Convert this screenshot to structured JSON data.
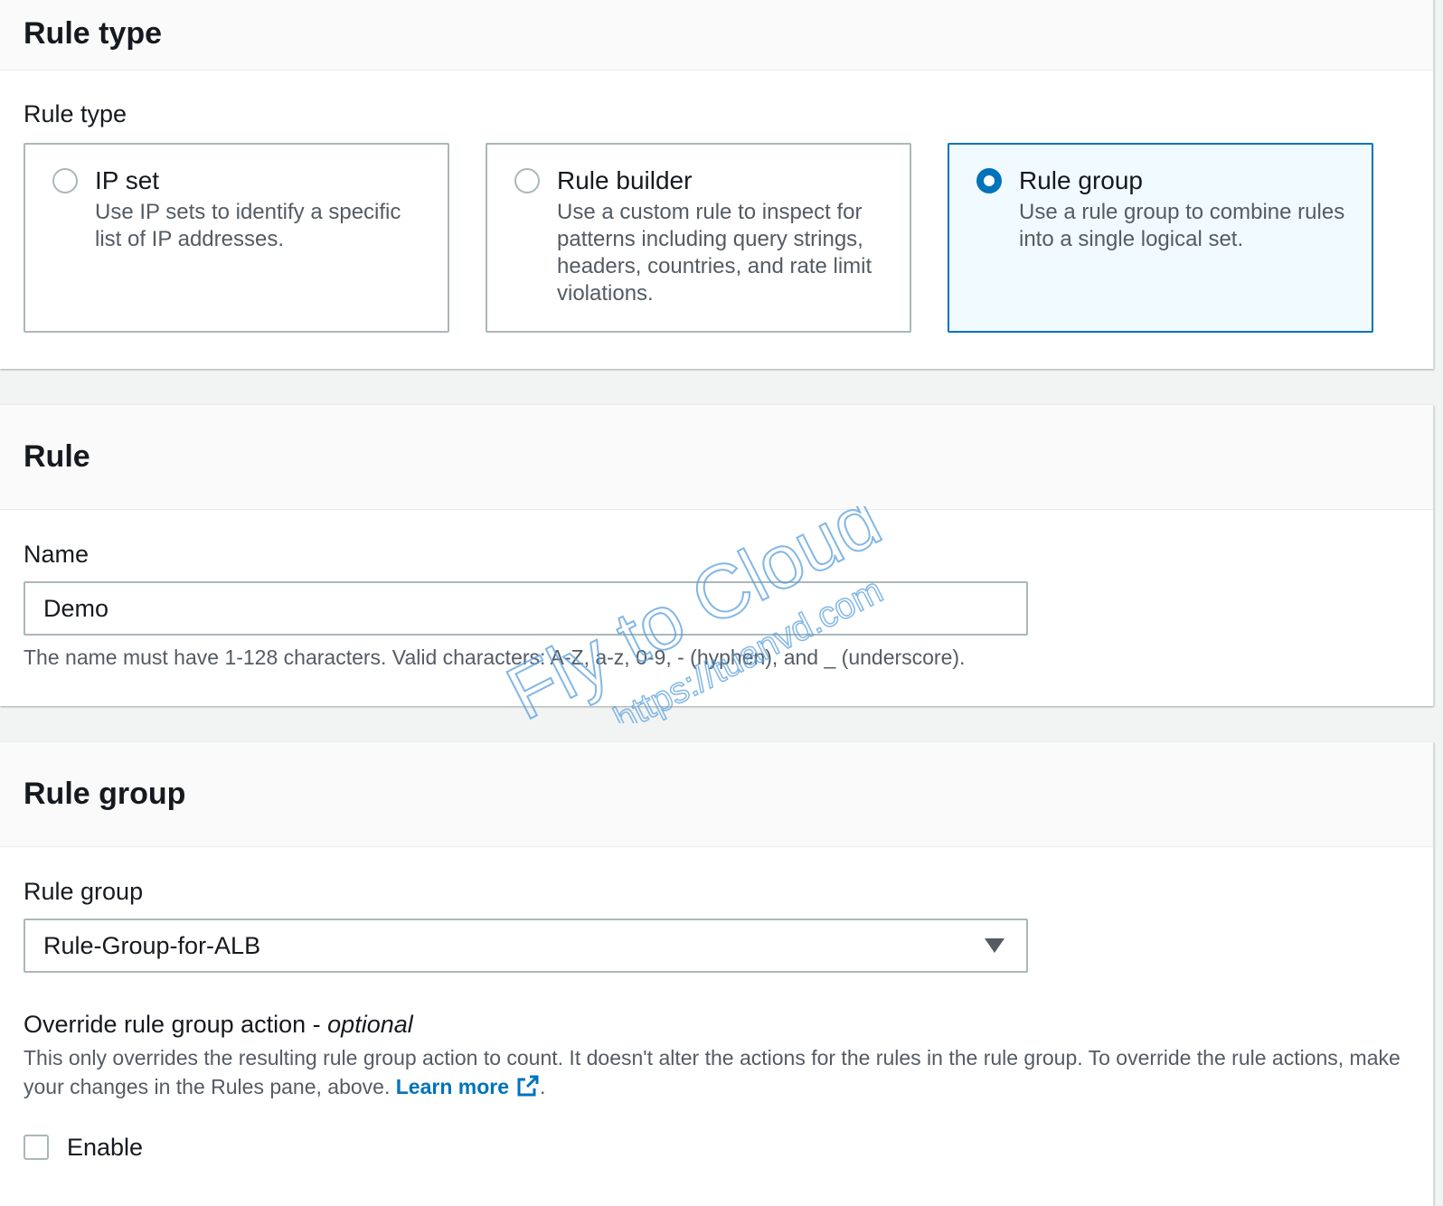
{
  "rule_type_section": {
    "header": "Rule type",
    "label": "Rule type",
    "tiles": [
      {
        "title": "IP set",
        "description": "Use IP sets to identify a specific list of IP addresses.",
        "selected": false
      },
      {
        "title": "Rule builder",
        "description": "Use a custom rule to inspect for patterns including query strings, headers, countries, and rate limit violations.",
        "selected": false
      },
      {
        "title": "Rule group",
        "description": "Use a rule group to combine rules into a single logical set.",
        "selected": true
      }
    ]
  },
  "rule_section": {
    "header": "Rule",
    "name_label": "Name",
    "name_value": "Demo",
    "name_constraint": "The name must have 1-128 characters. Valid characters: A-Z, a-z, 0-9, - (hyphen), and _ (underscore)."
  },
  "rule_group_section": {
    "header": "Rule group",
    "select_label": "Rule group",
    "select_value": "Rule-Group-for-ALB",
    "override_label": "Override rule group action - ",
    "override_optional": "optional",
    "override_description": "This only overrides the resulting rule group action to count. It doesn't alter the actions for the rules in the rule group. To override the rule actions, make your changes in the Rules pane, above. ",
    "learn_more": "Learn more",
    "period": ".",
    "enable_label": "Enable"
  },
  "watermark": {
    "line1": "Fly to Cloud",
    "line2": "https://tuanvd.com"
  },
  "colors": {
    "accent": "#0073bb",
    "border": "#aab7b8",
    "secondary_text": "#545b64",
    "selected_tile_bg": "#f1faff"
  },
  "icons": {
    "radio": "radio-circle",
    "caret": "caret-down-icon",
    "external": "external-link-icon",
    "checkbox": "checkbox-square"
  }
}
